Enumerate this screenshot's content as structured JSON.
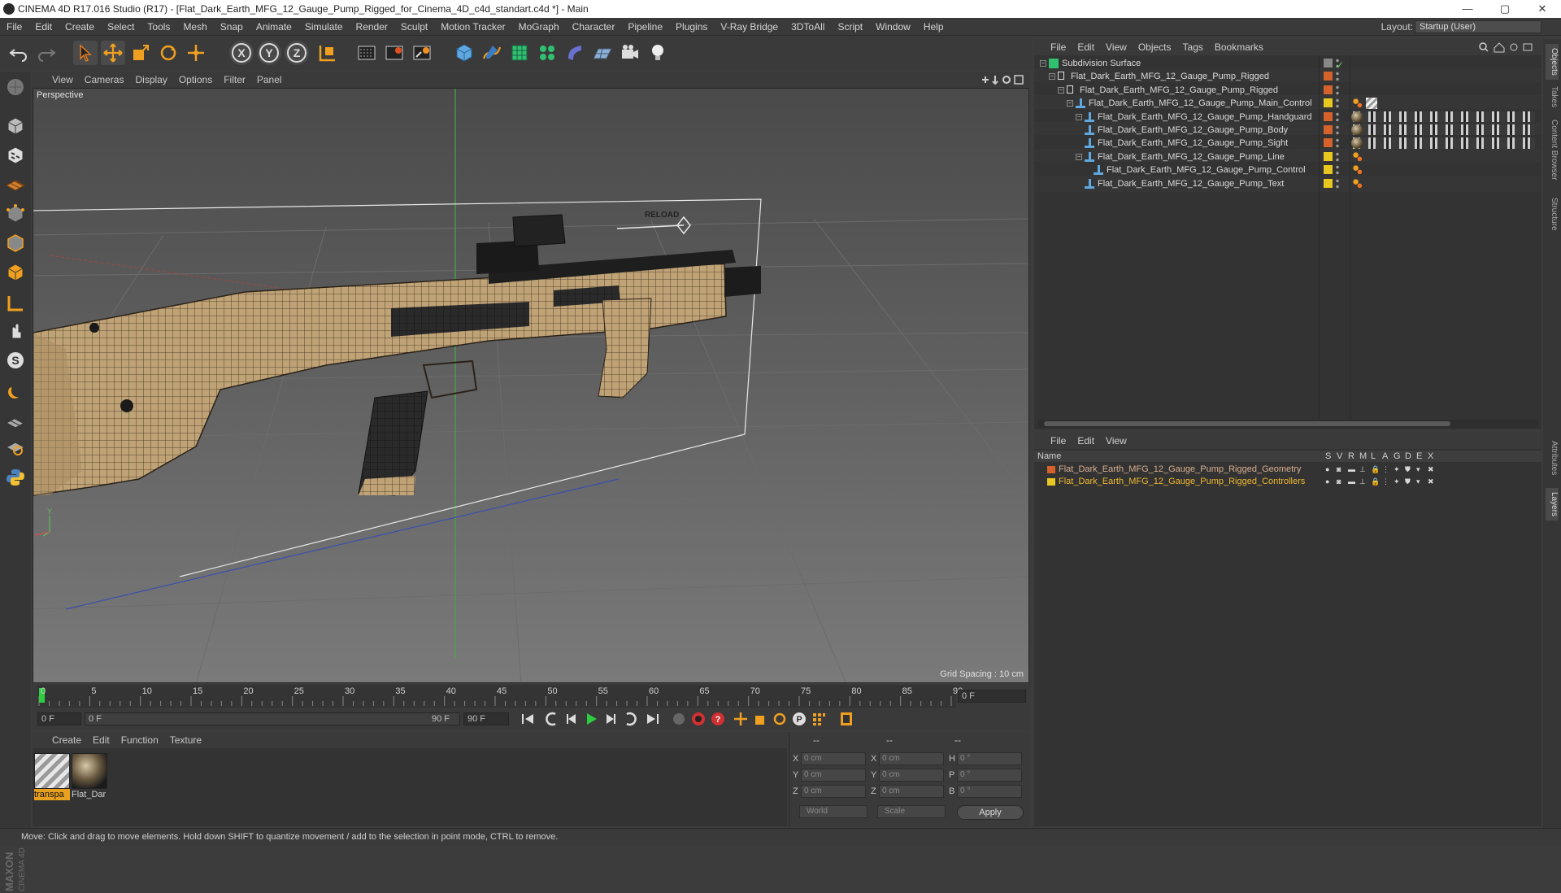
{
  "window": {
    "title": "CINEMA 4D R17.016 Studio (R17) - [Flat_Dark_Earth_MFG_12_Gauge_Pump_Rigged_for_Cinema_4D_c4d_standart.c4d *] - Main",
    "minimize": "—",
    "maximize": "▢",
    "close": "✕"
  },
  "menubar": {
    "items": [
      "File",
      "Edit",
      "Create",
      "Select",
      "Tools",
      "Mesh",
      "Snap",
      "Animate",
      "Simulate",
      "Render",
      "Sculpt",
      "Motion Tracker",
      "MoGraph",
      "Character",
      "Pipeline",
      "Plugins",
      "V-Ray Bridge",
      "3DToAll",
      "Script",
      "Window",
      "Help"
    ],
    "layout_label": "Layout:",
    "layout_value": "Startup (User)"
  },
  "toolbar": {
    "icons": [
      "undo-icon",
      "redo-icon",
      "live-selection-icon",
      "move-icon",
      "scale-icon",
      "rotate-icon",
      "last-tool-icon",
      "x-axis-icon",
      "y-axis-icon",
      "z-axis-icon",
      "world-coord-icon",
      "render-view-icon",
      "render-picture-viewer-icon",
      "edit-render-settings-icon",
      "cube-primitive-icon",
      "pen-spline-icon",
      "subdivision-icon",
      "cloner-icon",
      "deformer-icon",
      "floor-icon",
      "camera-icon",
      "light-icon"
    ],
    "axis_x": "X",
    "axis_y": "Y",
    "axis_z": "Z"
  },
  "viewport": {
    "menu": [
      "View",
      "Cameras",
      "Display",
      "Options",
      "Filter",
      "Panel"
    ],
    "label": "Perspective",
    "grid_spacing": "Grid Spacing : 10 cm",
    "overlay_text": "RELOAD"
  },
  "timeline": {
    "ticks": [
      "0",
      "5",
      "10",
      "15",
      "20",
      "25",
      "30",
      "35",
      "40",
      "45",
      "50",
      "55",
      "60",
      "65",
      "70",
      "75",
      "80",
      "85",
      "90"
    ],
    "current_frame": "0 F",
    "end_frame_display": "0 F"
  },
  "transport": {
    "start_field": "0 F",
    "range_start": "0 F",
    "range_end": "90 F",
    "end_field": "90 F"
  },
  "material_manager": {
    "menu": [
      "Create",
      "Edit",
      "Function",
      "Texture"
    ],
    "materials": [
      {
        "label": "transpa",
        "kind": "transparent"
      },
      {
        "label": "Flat_Dar",
        "kind": "earth"
      }
    ]
  },
  "coordinates": {
    "col_headers": [
      "--",
      "--",
      "--"
    ],
    "rows": [
      {
        "a": "X",
        "a_val": "0 cm",
        "b": "X",
        "b_val": "0 cm",
        "c": "H",
        "c_val": "0 °"
      },
      {
        "a": "Y",
        "a_val": "0 cm",
        "b": "Y",
        "b_val": "0 cm",
        "c": "P",
        "c_val": "0 °"
      },
      {
        "a": "Z",
        "a_val": "0 cm",
        "b": "Z",
        "b_val": "0 cm",
        "c": "B",
        "c_val": "0 °"
      }
    ],
    "mode": "World",
    "transform": "Scale",
    "apply": "Apply"
  },
  "object_manager": {
    "menu": [
      "File",
      "Edit",
      "View",
      "Objects",
      "Tags",
      "Bookmarks"
    ],
    "objects": [
      {
        "name": "Subdivision Surface",
        "indent": 0,
        "color": "#888888",
        "icon": "subdivision-icon"
      },
      {
        "name": "Flat_Dark_Earth_MFG_12_Gauge_Pump_Rigged",
        "indent": 1,
        "color": "#d4622a",
        "icon": "null-icon"
      },
      {
        "name": "Flat_Dark_Earth_MFG_12_Gauge_Pump_Rigged",
        "indent": 2,
        "color": "#d4622a",
        "icon": "null-icon"
      },
      {
        "name": "Flat_Dark_Earth_MFG_12_Gauge_Pump_Main_Control",
        "indent": 3,
        "color": "#e8c820",
        "icon": "joint-icon"
      },
      {
        "name": "Flat_Dark_Earth_MFG_12_Gauge_Pump_Handguard",
        "indent": 4,
        "color": "#d4622a",
        "icon": "joint-icon"
      },
      {
        "name": "Flat_Dark_Earth_MFG_12_Gauge_Pump_Body",
        "indent": 4,
        "color": "#d4622a",
        "icon": "joint-icon"
      },
      {
        "name": "Flat_Dark_Earth_MFG_12_Gauge_Pump_Sight",
        "indent": 4,
        "color": "#d4622a",
        "icon": "joint-icon"
      },
      {
        "name": "Flat_Dark_Earth_MFG_12_Gauge_Pump_Line",
        "indent": 4,
        "color": "#e8c820",
        "icon": "joint-icon"
      },
      {
        "name": "Flat_Dark_Earth_MFG_12_Gauge_Pump_Control",
        "indent": 5,
        "color": "#e8c820",
        "icon": "joint-icon"
      },
      {
        "name": "Flat_Dark_Earth_MFG_12_Gauge_Pump_Text",
        "indent": 4,
        "color": "#e8c820",
        "icon": "joint-icon"
      }
    ]
  },
  "layer_manager": {
    "menu": [
      "File",
      "Edit",
      "View"
    ],
    "header": {
      "name": "Name",
      "cols": [
        "S",
        "V",
        "R",
        "M",
        "L",
        "A",
        "G",
        "D",
        "E",
        "X"
      ]
    },
    "layers": [
      {
        "name": "Flat_Dark_Earth_MFG_12_Gauge_Pump_Rigged_Geometry",
        "color": "#d4622a",
        "text_color": "#d9b090"
      },
      {
        "name": "Flat_Dark_Earth_MFG_12_Gauge_Pump_Rigged_Controllers",
        "color": "#e8c820",
        "text_color": "#f0b830"
      }
    ]
  },
  "right_tabs": [
    "Objects",
    "Takes",
    "Content Browser",
    "Structure",
    "Attributes",
    "Layers"
  ],
  "status": "Move: Click and drag to move elements. Hold down SHIFT to quantize movement / add to the selection in point mode, CTRL to remove."
}
